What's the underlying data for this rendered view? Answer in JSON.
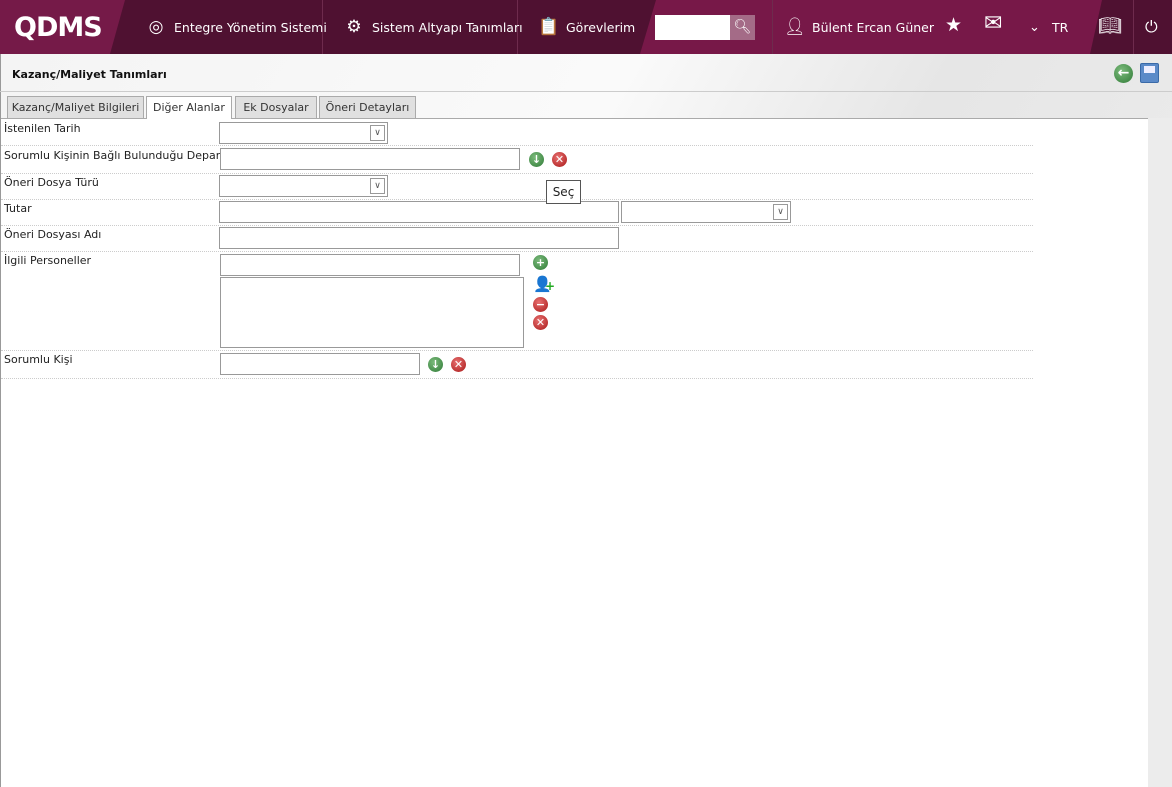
{
  "header": {
    "logo": "QDMS",
    "nav": [
      "Entegre Yönetim Sistemi",
      "Sistem Altyapı Tanımları",
      "Görevlerim"
    ],
    "search_placeholder": "",
    "user": "Bülent Ercan Güner",
    "language": "TR",
    "brand_color": "#771848"
  },
  "page": {
    "title": "Kazanç/Maliyet Tanımları"
  },
  "tabs": [
    "Kazanç/Maliyet Bilgileri",
    "Diğer Alanlar",
    "Ek Dosyalar",
    "Öneri Detayları"
  ],
  "active_tab": "Diğer Alanlar",
  "form": {
    "istenilen_tarih": {
      "label": "İstenilen Tarih",
      "value": ""
    },
    "departman": {
      "label": "Sorumlu Kişinin Bağlı Bulunduğu Departman",
      "value": ""
    },
    "dosya_turu": {
      "label": "Öneri Dosya Türü",
      "value": ""
    },
    "tutar": {
      "label": "Tutar",
      "value": "",
      "currency": ""
    },
    "dosya_adi": {
      "label": "Öneri Dosyası Adı",
      "value": ""
    },
    "personeller": {
      "label": "İlgili Personeller",
      "value": ""
    },
    "sorumlu": {
      "label": "Sorumlu Kişi",
      "value": ""
    }
  },
  "tooltip": "Seç"
}
